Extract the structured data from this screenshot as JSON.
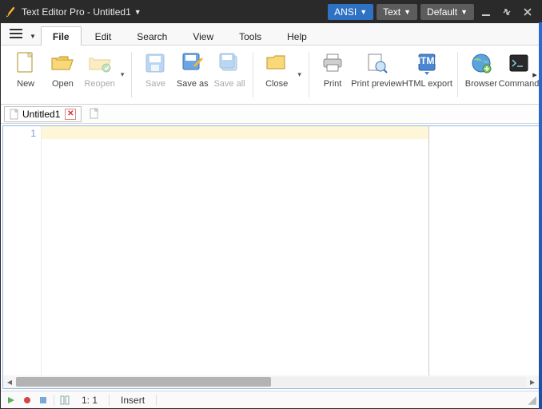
{
  "titlebar": {
    "app_name": "Text Editor Pro",
    "document": "Untitled1",
    "separator": "  -  ",
    "encoding_label": "ANSI",
    "type_label": "Text",
    "theme_label": "Default"
  },
  "menu": {
    "tabs": [
      "File",
      "Edit",
      "Search",
      "View",
      "Tools",
      "Help"
    ],
    "active_index": 0
  },
  "ribbon": {
    "items": [
      {
        "label": "New",
        "icon": "doc-new",
        "disabled": false
      },
      {
        "label": "Open",
        "icon": "folder-open",
        "disabled": false
      },
      {
        "label": "Reopen",
        "icon": "folder-reopen",
        "disabled": true,
        "dropdown": true
      },
      {
        "sep": true
      },
      {
        "label": "Save",
        "icon": "floppy",
        "disabled": true
      },
      {
        "label": "Save as",
        "icon": "floppy-as",
        "disabled": false
      },
      {
        "label": "Save all",
        "icon": "floppy-all",
        "disabled": true
      },
      {
        "sep": true
      },
      {
        "label": "Close",
        "icon": "folder-close",
        "disabled": false,
        "dropdown": true
      },
      {
        "sep": true
      },
      {
        "label": "Print",
        "icon": "printer",
        "disabled": false
      },
      {
        "label": "Print preview",
        "icon": "print-preview",
        "disabled": false
      },
      {
        "label": "HTML export",
        "icon": "html-export",
        "disabled": false
      },
      {
        "sep": true
      },
      {
        "label": "Browser",
        "icon": "globe",
        "disabled": false
      },
      {
        "label": "Command",
        "icon": "terminal",
        "disabled": false
      }
    ]
  },
  "doctabs": {
    "tabs": [
      {
        "label": "Untitled1"
      }
    ]
  },
  "editor": {
    "line_number": "1"
  },
  "status": {
    "position": "1: 1",
    "mode": "Insert"
  }
}
